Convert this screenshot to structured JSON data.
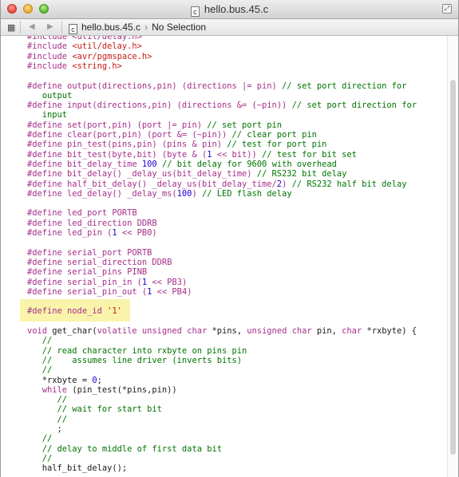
{
  "window": {
    "title": "hello.bus.45.c",
    "file_icon_glyph": "c"
  },
  "jumpbar": {
    "grid_glyph": "▦",
    "back_glyph": "◀",
    "forward_glyph": "▶",
    "file_icon_glyph": "c",
    "filename": "hello.bus.45.c",
    "chevron": "›",
    "selection": "No Selection"
  },
  "colors": {
    "keyword": "#a52f8a",
    "string": "#c41a16",
    "comment": "#007400",
    "number": "#1c00cf",
    "highlight": "#faf3a6"
  },
  "code_lines": [
    [
      {
        "t": "#include <util/delay.h>",
        "c": "prep"
      }
    ],
    [
      {
        "t": "#include ",
        "c": "prep"
      },
      {
        "t": "<util/delay.h>",
        "c": "str"
      }
    ],
    [
      {
        "t": "#include ",
        "c": "prep"
      },
      {
        "t": "<avr/pgmspace.h>",
        "c": "str"
      }
    ],
    [
      {
        "t": "#include ",
        "c": "prep"
      },
      {
        "t": "<string.h>",
        "c": "str"
      }
    ],
    [],
    [
      {
        "t": "#define output(directions,pin) (directions |= pin) ",
        "c": "prep"
      },
      {
        "t": "// set port direction for",
        "c": "com"
      }
    ],
    [
      {
        "t": "   output",
        "c": "com"
      }
    ],
    [
      {
        "t": "#define input(directions,pin) (directions &= (~pin)) ",
        "c": "prep"
      },
      {
        "t": "// set port direction for",
        "c": "com"
      }
    ],
    [
      {
        "t": "   input",
        "c": "com"
      }
    ],
    [
      {
        "t": "#define set(port,pin) (port |= pin) ",
        "c": "prep"
      },
      {
        "t": "// set port pin",
        "c": "com"
      }
    ],
    [
      {
        "t": "#define clear(port,pin) (port &= (~pin)) ",
        "c": "prep"
      },
      {
        "t": "// clear port pin",
        "c": "com"
      }
    ],
    [
      {
        "t": "#define pin_test(pins,pin) (pins & pin) ",
        "c": "prep"
      },
      {
        "t": "// test for port pin",
        "c": "com"
      }
    ],
    [
      {
        "t": "#define bit_test(byte,bit) (byte & (",
        "c": "prep"
      },
      {
        "t": "1",
        "c": "num"
      },
      {
        "t": " << bit)) ",
        "c": "prep"
      },
      {
        "t": "// test for bit set",
        "c": "com"
      }
    ],
    [
      {
        "t": "#define bit_delay_time ",
        "c": "prep"
      },
      {
        "t": "100",
        "c": "num"
      },
      {
        "t": " ",
        "c": "prep"
      },
      {
        "t": "// bit delay for 9600 with overhead",
        "c": "com"
      }
    ],
    [
      {
        "t": "#define bit_delay() _delay_us(bit_delay_time) ",
        "c": "prep"
      },
      {
        "t": "// RS232 bit delay",
        "c": "com"
      }
    ],
    [
      {
        "t": "#define half_bit_delay() _delay_us(bit_delay_time/",
        "c": "prep"
      },
      {
        "t": "2",
        "c": "num"
      },
      {
        "t": ") ",
        "c": "prep"
      },
      {
        "t": "// RS232 half bit delay",
        "c": "com"
      }
    ],
    [
      {
        "t": "#define led_delay() _delay_ms(",
        "c": "prep"
      },
      {
        "t": "100",
        "c": "num"
      },
      {
        "t": ") ",
        "c": "prep"
      },
      {
        "t": "// LED flash delay",
        "c": "com"
      }
    ],
    [],
    [
      {
        "t": "#define led_port PORTB",
        "c": "prep"
      }
    ],
    [
      {
        "t": "#define led_direction DDRB",
        "c": "prep"
      }
    ],
    [
      {
        "t": "#define led_pin (",
        "c": "prep"
      },
      {
        "t": "1",
        "c": "num"
      },
      {
        "t": " << PB0)",
        "c": "prep"
      }
    ],
    [],
    [
      {
        "t": "#define serial_port PORTB",
        "c": "prep"
      }
    ],
    [
      {
        "t": "#define serial_direction DDRB",
        "c": "prep"
      }
    ],
    [
      {
        "t": "#define serial_pins PINB",
        "c": "prep"
      }
    ],
    [
      {
        "t": "#define serial_pin_in (",
        "c": "prep"
      },
      {
        "t": "1",
        "c": "num"
      },
      {
        "t": " << PB3)",
        "c": "prep"
      }
    ],
    [
      {
        "t": "#define serial_pin_out (",
        "c": "prep"
      },
      {
        "t": "1",
        "c": "num"
      },
      {
        "t": " << PB4)",
        "c": "prep"
      }
    ],
    [],
    [
      {
        "t": "#define node_id ",
        "c": "prep"
      },
      {
        "t": "'1'",
        "c": "str"
      }
    ],
    [],
    [
      {
        "t": "void",
        "c": "kw"
      },
      {
        "t": " get_char(",
        "c": ""
      },
      {
        "t": "volatile unsigned char",
        "c": "kw"
      },
      {
        "t": " *pins, ",
        "c": ""
      },
      {
        "t": "unsigned char",
        "c": "kw"
      },
      {
        "t": " pin, ",
        "c": ""
      },
      {
        "t": "char",
        "c": "kw"
      },
      {
        "t": " *rxbyte) {",
        "c": ""
      }
    ],
    [
      {
        "t": "   //",
        "c": "com"
      }
    ],
    [
      {
        "t": "   // read character into rxbyte on pins pin",
        "c": "com"
      }
    ],
    [
      {
        "t": "   //    assumes line driver (inverts bits)",
        "c": "com"
      }
    ],
    [
      {
        "t": "   //",
        "c": "com"
      }
    ],
    [
      {
        "t": "   *rxbyte = ",
        "c": ""
      },
      {
        "t": "0",
        "c": "num"
      },
      {
        "t": ";",
        "c": ""
      }
    ],
    [
      {
        "t": "   ",
        "c": ""
      },
      {
        "t": "while",
        "c": "kw"
      },
      {
        "t": " (pin_test(*pins,pin))",
        "c": ""
      }
    ],
    [
      {
        "t": "      //",
        "c": "com"
      }
    ],
    [
      {
        "t": "      // wait for start bit",
        "c": "com"
      }
    ],
    [
      {
        "t": "      //",
        "c": "com"
      }
    ],
    [
      {
        "t": "      ;",
        "c": ""
      }
    ],
    [
      {
        "t": "   //",
        "c": "com"
      }
    ],
    [
      {
        "t": "   // delay to middle of first data bit",
        "c": "com"
      }
    ],
    [
      {
        "t": "   //",
        "c": "com"
      }
    ],
    [
      {
        "t": "   half_bit_delay();",
        "c": ""
      }
    ]
  ]
}
